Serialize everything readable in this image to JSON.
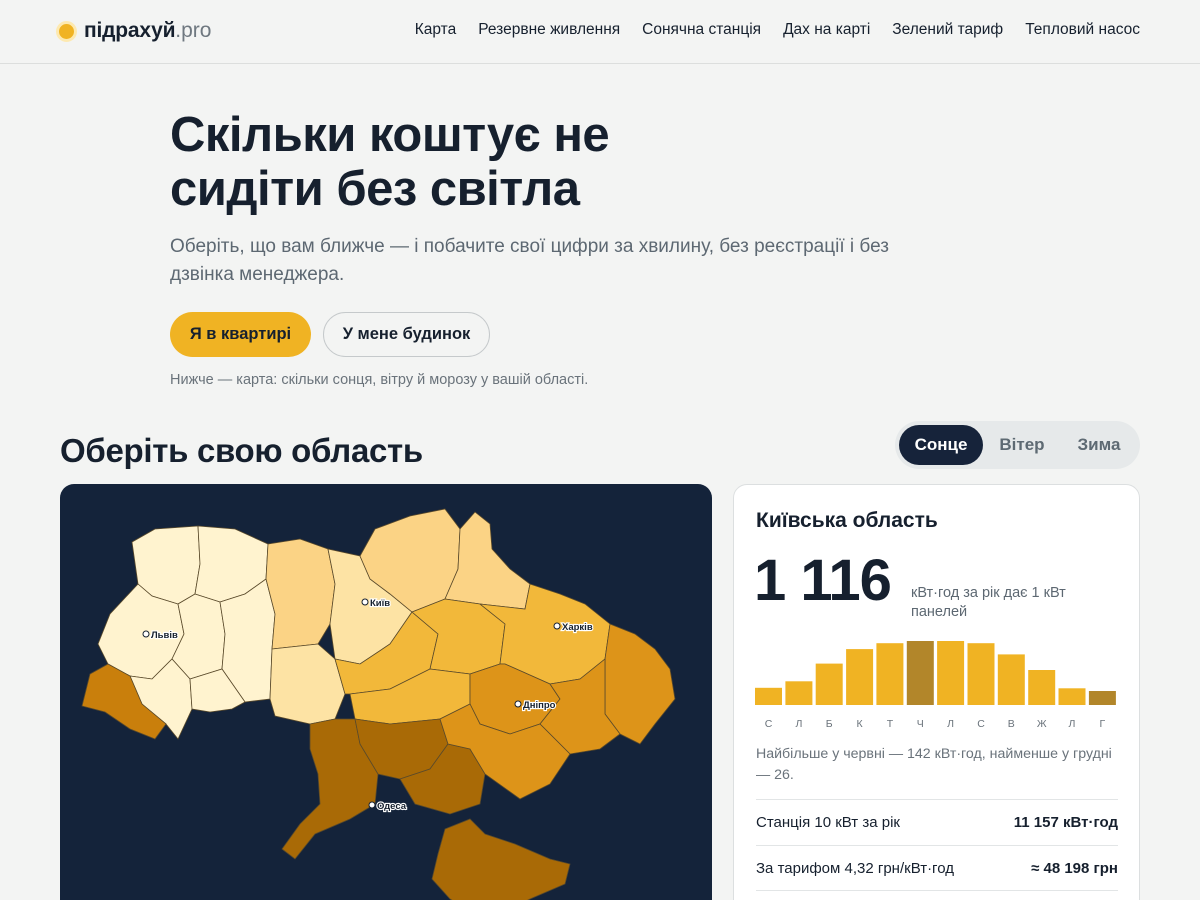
{
  "header": {
    "logo_main": "підрахуй",
    "logo_suffix": ".pro",
    "nav": [
      "Карта",
      "Резервне живлення",
      "Сонячна станція",
      "Дах на карті",
      "Зелений тариф",
      "Тепловий насос"
    ]
  },
  "hero": {
    "title_line1": "Скільки коштує не",
    "title_line2": "сидіти без світла",
    "subtitle": "Оберіть, що вам ближче — і побачите свої цифри за хвилину, без реєстрації і без дзвінка менеджера.",
    "btn_apartment": "Я в квартирі",
    "btn_house": "У мене будинок",
    "note": "Нижче — карта: скільки сонця, вітру й морозу у вашій області."
  },
  "regions_section": {
    "title": "Оберіть свою область",
    "toggle": [
      "Сонце",
      "Вітер",
      "Зима"
    ],
    "active_toggle": "Сонце"
  },
  "map": {
    "cities": [
      "Львів",
      "Київ",
      "Харків",
      "Дніпро",
      "Одеса"
    ],
    "colors": [
      "#fff3cf",
      "#fde3a4",
      "#fbd385",
      "#f2b83a",
      "#dd9419",
      "#c97f0c",
      "#a96a06"
    ]
  },
  "card": {
    "region": "Київська область",
    "yield": "1 116",
    "yield_unit": "кВт·год за рік дає 1 кВт панелей",
    "months": [
      "С",
      "Л",
      "Б",
      "К",
      "Т",
      "Ч",
      "Л",
      "С",
      "В",
      "Ж",
      "Л",
      "Г"
    ],
    "monthly_values": [
      32,
      44,
      77,
      104,
      115,
      119,
      119,
      115,
      94,
      65,
      31,
      26
    ],
    "highlight_month_index": 5,
    "highlight_last_index": 11,
    "bar_color": "#f0b323",
    "bar_highlight_color": "#b2862a",
    "note": "Найбільше у червні — 142 кВт·год, найменше у грудні — 26.",
    "rows": [
      {
        "label": "Станція 10 кВт за рік",
        "value": "11 157 кВт·год"
      },
      {
        "label": "За тарифом 4,32 грн/кВт·год",
        "value": "≈ 48 198 грн"
      }
    ]
  }
}
